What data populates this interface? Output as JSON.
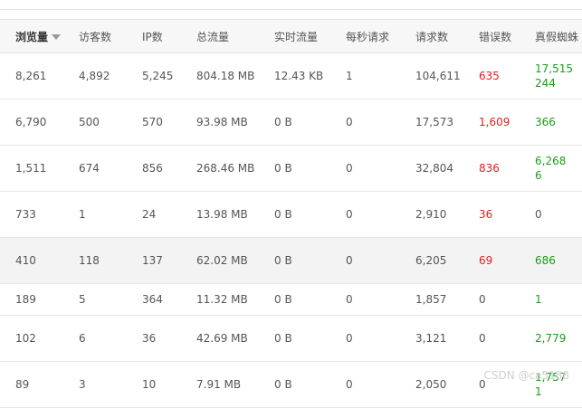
{
  "columns": [
    "浏览量",
    "访客数",
    "IP数",
    "总流量",
    "实时流量",
    "每秒请求",
    "请求数",
    "错误数",
    "真假蜘蛛"
  ],
  "sort_icon": "sort-desc-icon",
  "colors": {
    "error": "#e02020",
    "spider": "#1a9e1a",
    "row_highlight": "#f3f3f3"
  },
  "rows": [
    {
      "pv": "8,261",
      "uv": "4,892",
      "ip": "5,245",
      "total": "804.18 MB",
      "realtime": "12.43 KB",
      "rps": "1",
      "requests": "104,611",
      "errors": "635",
      "spider_line1": "17,515",
      "spider_line2": "244"
    },
    {
      "pv": "6,790",
      "uv": "500",
      "ip": "570",
      "total": "93.98 MB",
      "realtime": "0 B",
      "rps": "0",
      "requests": "17,573",
      "errors": "1,609",
      "spider_line1": "366",
      "spider_line2": ""
    },
    {
      "pv": "1,511",
      "uv": "674",
      "ip": "856",
      "total": "268.46 MB",
      "realtime": "0 B",
      "rps": "0",
      "requests": "32,804",
      "errors": "836",
      "spider_line1": "6,268",
      "spider_line2": "6"
    },
    {
      "pv": "733",
      "uv": "1",
      "ip": "24",
      "total": "13.98 MB",
      "realtime": "0 B",
      "rps": "0",
      "requests": "2,910",
      "errors": "36",
      "spider_line1": "0",
      "spider_line2": ""
    },
    {
      "pv": "410",
      "uv": "118",
      "ip": "137",
      "total": "62.02 MB",
      "realtime": "0 B",
      "rps": "0",
      "requests": "6,205",
      "errors": "69",
      "spider_line1": "686",
      "spider_line2": ""
    },
    {
      "pv": "189",
      "uv": "5",
      "ip": "364",
      "total": "11.32 MB",
      "realtime": "0 B",
      "rps": "0",
      "requests": "1,857",
      "errors": "0",
      "spider_line1": "1",
      "spider_line2": ""
    },
    {
      "pv": "102",
      "uv": "6",
      "ip": "36",
      "total": "42.69 MB",
      "realtime": "0 B",
      "rps": "0",
      "requests": "3,121",
      "errors": "0",
      "spider_line1": "2,779",
      "spider_line2": ""
    },
    {
      "pv": "89",
      "uv": "3",
      "ip": "10",
      "total": "7.91 MB",
      "realtime": "0 B",
      "rps": "0",
      "requests": "2,050",
      "errors": "0",
      "spider_line1": "1,757",
      "spider_line2": "1"
    }
  ],
  "watermark": "CSDN @ca5188"
}
